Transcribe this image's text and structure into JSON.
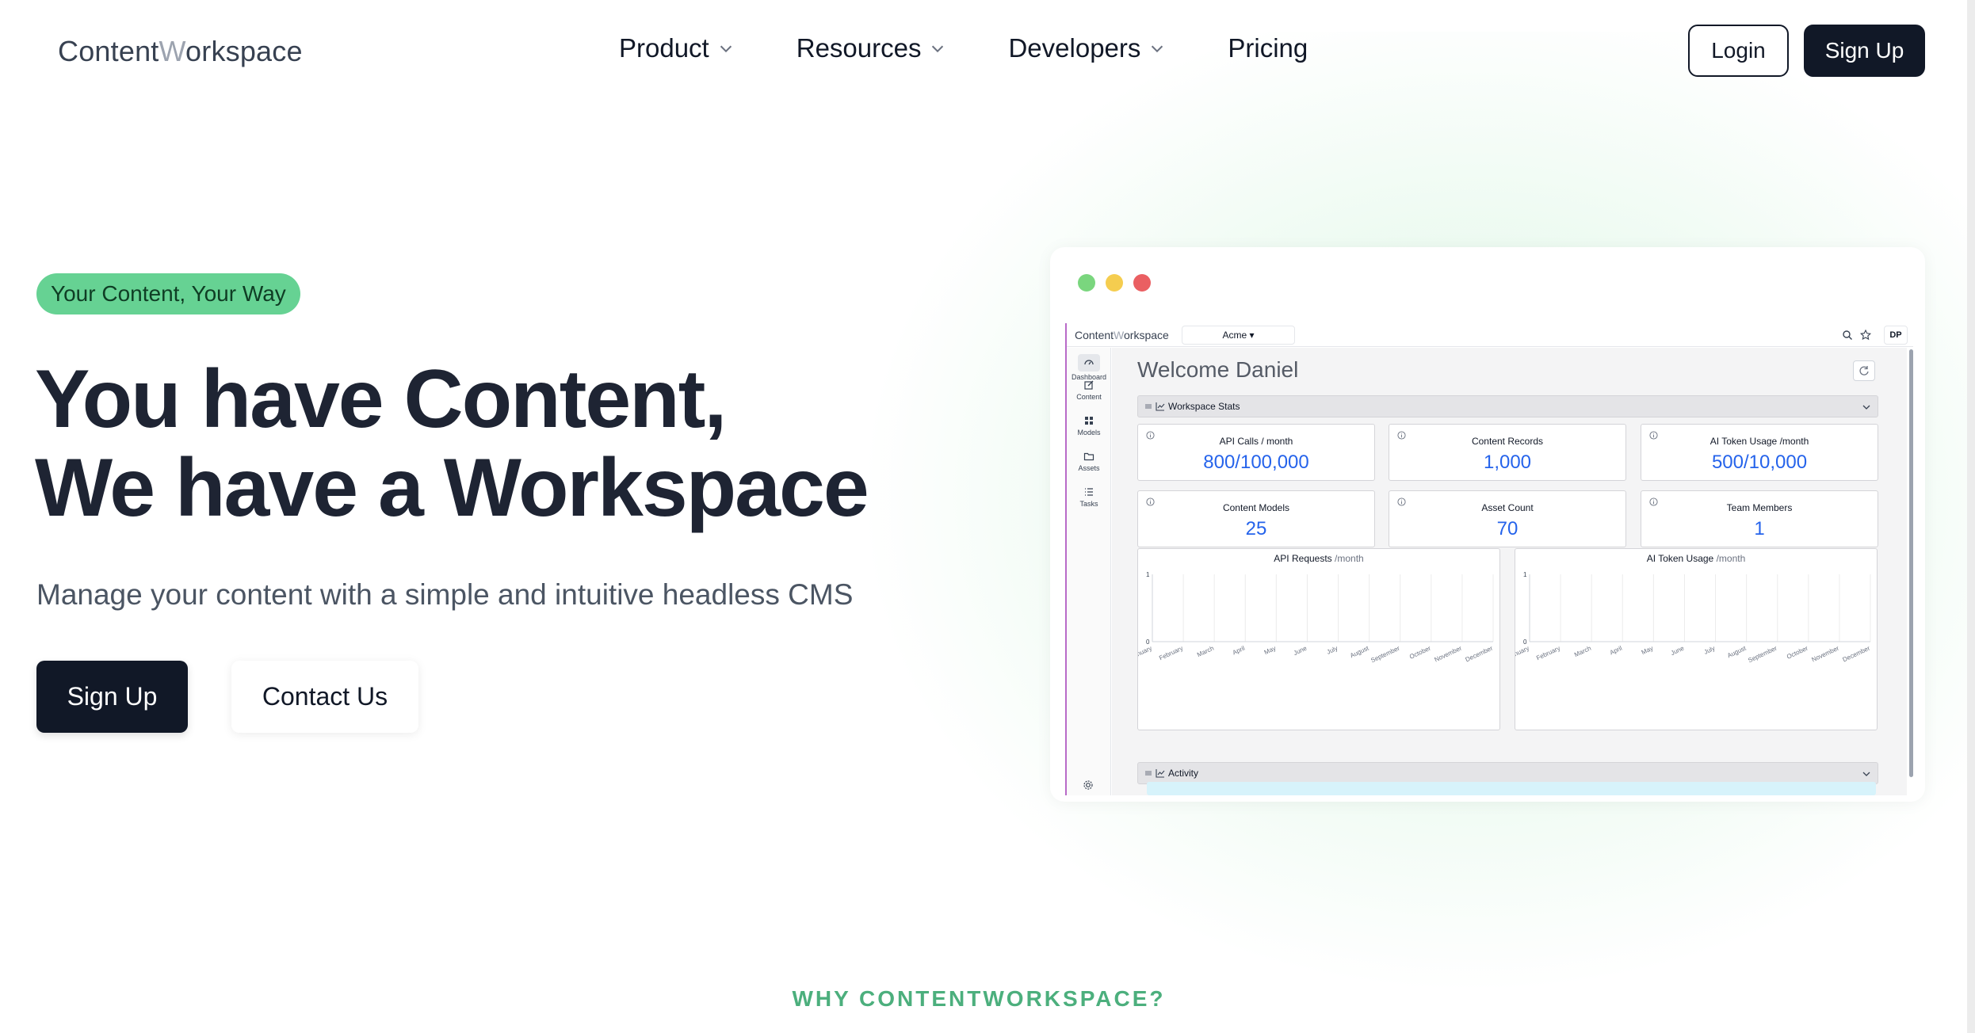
{
  "nav": {
    "logo_a": "Content",
    "logo_b": "W",
    "logo_c": "orkspace",
    "menu": [
      {
        "label": "Product",
        "dropdown": true
      },
      {
        "label": "Resources",
        "dropdown": true
      },
      {
        "label": "Developers",
        "dropdown": true
      },
      {
        "label": "Pricing",
        "dropdown": false
      }
    ],
    "login": "Login",
    "signup": "Sign Up"
  },
  "hero": {
    "badge": "Your Content, Your Way",
    "headline_1": "You have Content,",
    "headline_2": "We have a Workspace",
    "subhead": "Manage your content with a simple and intuitive headless CMS",
    "signup": "Sign Up",
    "contact": "Contact Us"
  },
  "why": "WHY CONTENTWORKSPACE?",
  "preview": {
    "logo_a": "Content",
    "logo_b": "W",
    "logo_c": "orkspace",
    "workspace_select": "Acme ▾",
    "avatar": "DP",
    "sidebar": [
      {
        "label": "Dashboard",
        "icon": "dashboard-icon"
      },
      {
        "label": "Content",
        "icon": "edit-icon"
      },
      {
        "label": "Models",
        "icon": "grid-icon"
      },
      {
        "label": "Assets",
        "icon": "folder-icon"
      },
      {
        "label": "Tasks",
        "icon": "list-icon"
      }
    ],
    "welcome": "Welcome Daniel",
    "stats_section": "Workspace Stats",
    "stats": [
      {
        "title": "API Calls / month",
        "value": "800/100,000"
      },
      {
        "title": "Content Records",
        "value": "1,000"
      },
      {
        "title": "AI Token Usage /month",
        "value": "500/10,000"
      },
      {
        "title": "Content Models",
        "value": "25"
      },
      {
        "title": "Asset Count",
        "value": "70"
      },
      {
        "title": "Team Members",
        "value": "1"
      }
    ],
    "activity_section": "Activity"
  },
  "chart_data": [
    {
      "type": "line",
      "title": "API Requests",
      "title_unit": "/month",
      "categories": [
        "January",
        "February",
        "March",
        "April",
        "May",
        "June",
        "July",
        "August",
        "September",
        "October",
        "November",
        "December"
      ],
      "yticks": [
        "1",
        "0"
      ],
      "ylim": [
        0,
        1
      ],
      "series": []
    },
    {
      "type": "line",
      "title": "AI Token Usage",
      "title_unit": "/month",
      "categories": [
        "January",
        "February",
        "March",
        "April",
        "May",
        "June",
        "July",
        "August",
        "September",
        "October",
        "November",
        "December"
      ],
      "yticks": [
        "1",
        "0"
      ],
      "ylim": [
        0,
        1
      ],
      "series": []
    }
  ],
  "colors": {
    "dark": "#111827",
    "badge": "#66d293",
    "accent_green": "#4caf7d",
    "stat_value": "#2563eb",
    "traffic_green": "#7ad67e",
    "traffic_yellow": "#f5cd4f",
    "traffic_red": "#ea5f62"
  }
}
